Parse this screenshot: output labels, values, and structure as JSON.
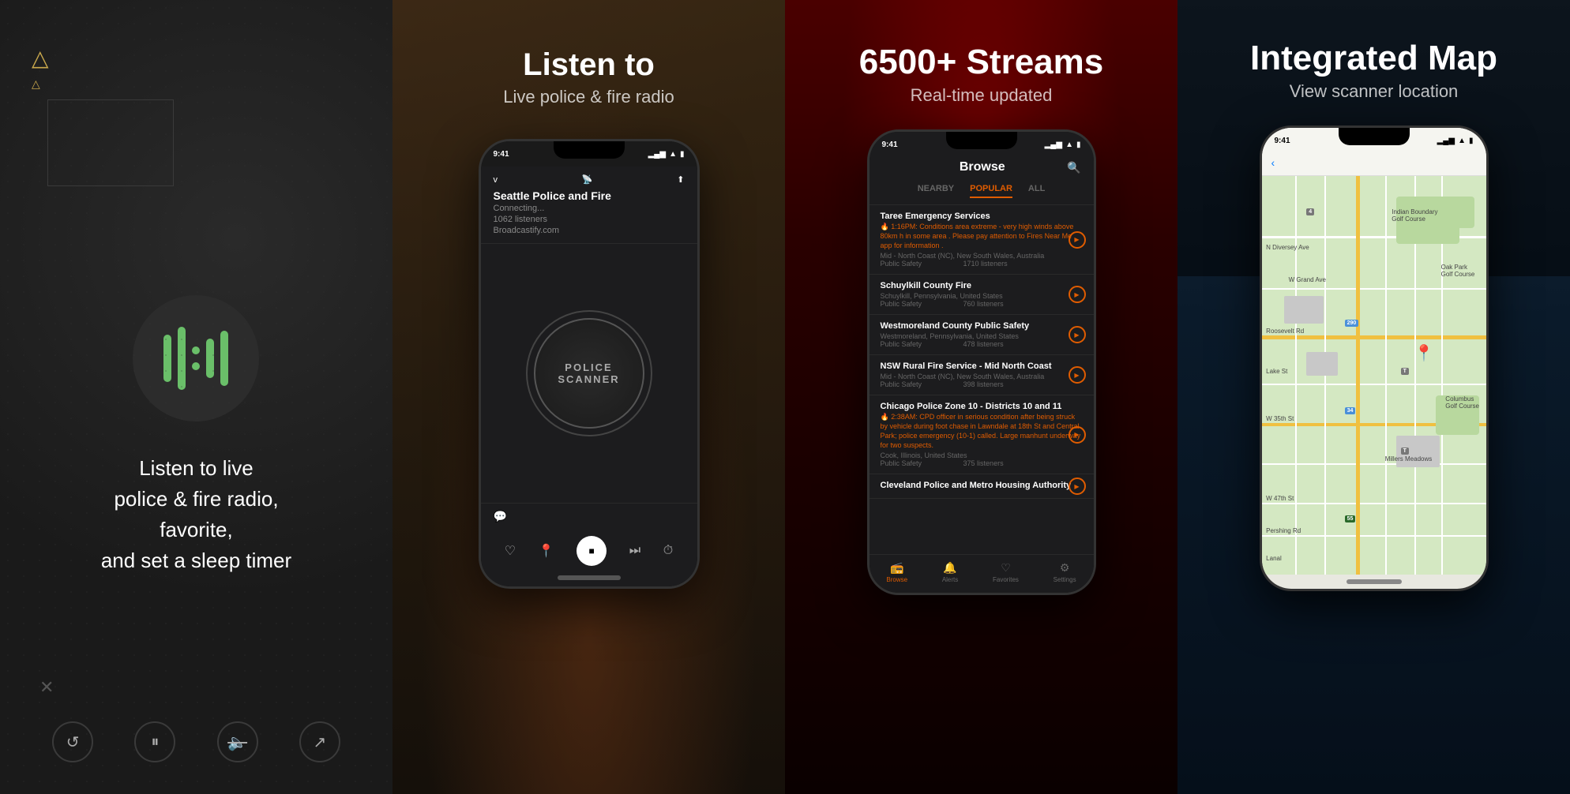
{
  "panel1": {
    "description_text": "Listen to live\npolice & fire radio,\nfavorite,\nand set a sleep timer",
    "controls": {
      "replay": "↺",
      "pause": "⏸",
      "mute": "🔇",
      "arrow": "↗"
    }
  },
  "panel2": {
    "title": "Listen to",
    "subtitle": "Live police & fire radio",
    "phone": {
      "status_time": "9:41",
      "station_name": "Seattle Police and Fire",
      "station_connecting": "Connecting...",
      "station_listeners": "1062 listeners",
      "station_url": "Broadcastify.com",
      "scanner_text_1": "POLICE",
      "scanner_text_2": "SCANNER",
      "chevron_down": "v",
      "radio_icon": "📡",
      "share_icon": "⬆"
    }
  },
  "panel3": {
    "title": "6500+ Streams",
    "subtitle": "Real-time updated",
    "phone": {
      "status_time": "9:41",
      "browse_title": "Browse",
      "tabs": [
        {
          "label": "NEARBY",
          "active": false
        },
        {
          "label": "POPULAR",
          "active": true
        },
        {
          "label": "ALL",
          "active": false
        }
      ],
      "stations": [
        {
          "name": "Taree Emergency Services",
          "alert": "🔥 1:16PM: Conditions area extreme - very high winds above 80km h in some area . Please pay attention to Fires Near Me app for information .",
          "meta": "Mid - North Coast (NC), New South Wales, Australia",
          "category": "Public Safety",
          "listeners": "1710 listeners"
        },
        {
          "name": "Schuylkill County Fire",
          "alert": "",
          "meta": "Schuylkill, Pennsylvania, United States",
          "category": "Public Safety",
          "listeners": "760 listeners"
        },
        {
          "name": "Westmoreland County Public Safety",
          "alert": "",
          "meta": "Westmoreland, Pennsylvania, United States",
          "category": "Public Safety",
          "listeners": "478 listeners"
        },
        {
          "name": "NSW Rural Fire Service - Mid North Coast",
          "alert": "",
          "meta": "Mid - North Coast (NC), New South Wales, Australia",
          "category": "Public Safety",
          "listeners": "398 listeners"
        },
        {
          "name": "Chicago Police Zone 10 - Districts 10 and 11",
          "alert": "🔥 2:38AM: CPD officer in serious condition after being struck by vehicle during foot chase in Lawndale at 18th St and Central Park; police emergency (10-1) called. Large manhunt underway for two suspects.",
          "meta": "Cook, Illinois, United States",
          "category": "Public Safety",
          "listeners": "375 listeners"
        },
        {
          "name": "Cleveland Police and Metro Housing Authority",
          "alert": "",
          "meta": "",
          "category": "",
          "listeners": ""
        }
      ],
      "nav": [
        {
          "label": "Browse",
          "icon": "📻",
          "active": true
        },
        {
          "label": "Alerts",
          "icon": "🔔",
          "active": false
        },
        {
          "label": "Favorites",
          "icon": "♡",
          "active": false
        },
        {
          "label": "Settings",
          "icon": "⚙",
          "active": false
        }
      ]
    }
  },
  "panel4": {
    "title": "Integrated Map",
    "subtitle": "View scanner location",
    "phone": {
      "status_time": "9:41",
      "back_label": "‹"
    }
  }
}
